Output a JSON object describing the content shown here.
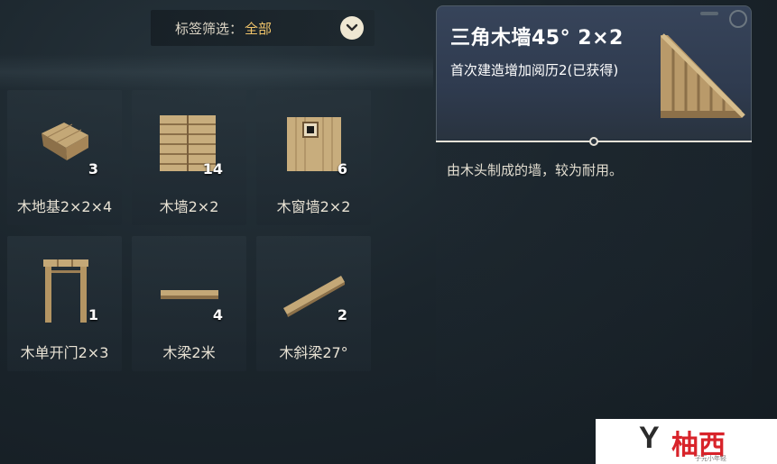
{
  "filter": {
    "label": "标签筛选：",
    "value": "全部",
    "toggle_icon": "chevron-down-icon"
  },
  "items": [
    {
      "name": "木地基2×2×4",
      "count": "3",
      "icon": "wood-foundation-icon"
    },
    {
      "name": "木墙2×2",
      "count": "14",
      "icon": "wood-wall-icon"
    },
    {
      "name": "木窗墙2×2",
      "count": "6",
      "icon": "wood-window-wall-icon"
    },
    {
      "name": "木单开门2×3",
      "count": "1",
      "icon": "wood-door-icon"
    },
    {
      "name": "木梁2米",
      "count": "4",
      "icon": "wood-beam-icon"
    },
    {
      "name": "木斜梁27°",
      "count": "2",
      "icon": "wood-slanted-beam-icon"
    }
  ],
  "detail": {
    "title": "三角木墙45° 2×2",
    "subtitle": "首次建造增加阅历2(已获得)",
    "description": "由木头制成的墙，较为耐用。",
    "icon": "triangle-wood-wall-icon"
  },
  "watermark": {
    "letter": "Y",
    "text": "柚西",
    "small": "子元小年轻"
  },
  "colors": {
    "accent": "#f0c46a",
    "wood": "#b99a6a",
    "watermark_red": "#d8232a"
  }
}
